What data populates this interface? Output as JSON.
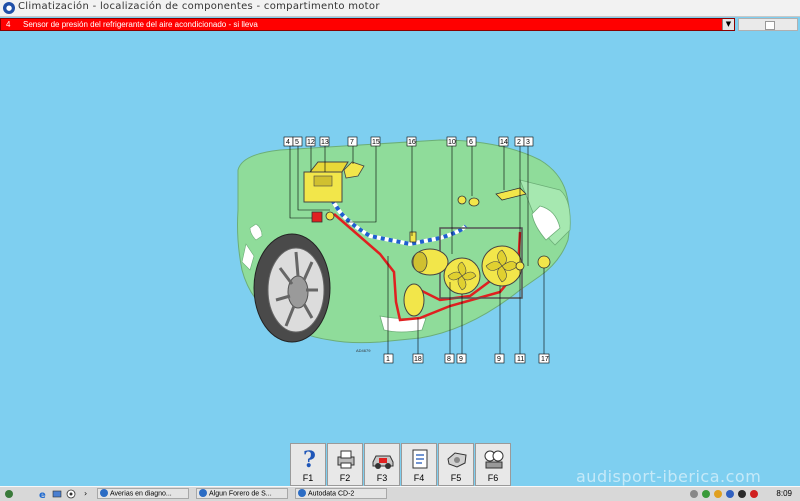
{
  "window": {
    "title": "Climatización - localización de componentes - compartimento motor",
    "app_icon": "autodata-logo-icon"
  },
  "selector": {
    "number": "4",
    "text": "Sensor de presión del refrigerante del aire acondicionado - si lleva",
    "background_color": "#ff0000"
  },
  "diagram": {
    "background_color": "#7ecff0",
    "car_color": "#8fdc9a",
    "code": "AD4679",
    "callouts_top": [
      "4",
      "5",
      "12",
      "13",
      "7",
      "15",
      "16",
      "10",
      "6",
      "14",
      "2",
      "3"
    ],
    "callouts_bottom": [
      "1",
      "18",
      "8",
      "9",
      "9",
      "11",
      "17"
    ]
  },
  "fkeys": [
    {
      "label": "F1",
      "icon": "help-question-icon"
    },
    {
      "label": "F2",
      "icon": "printer-icon"
    },
    {
      "label": "F3",
      "icon": "car-icon"
    },
    {
      "label": "F4",
      "icon": "document-icon"
    },
    {
      "label": "F5",
      "icon": "component-icon"
    },
    {
      "label": "F6",
      "icon": "gauge-icon"
    }
  ],
  "taskbar": {
    "tasks": [
      {
        "label": "Averias en diagno..."
      },
      {
        "label": "Algun Forero de S..."
      },
      {
        "label": "Autodata CD-2"
      }
    ],
    "clock": "8:09"
  },
  "watermark": "audisport-iberica.com"
}
